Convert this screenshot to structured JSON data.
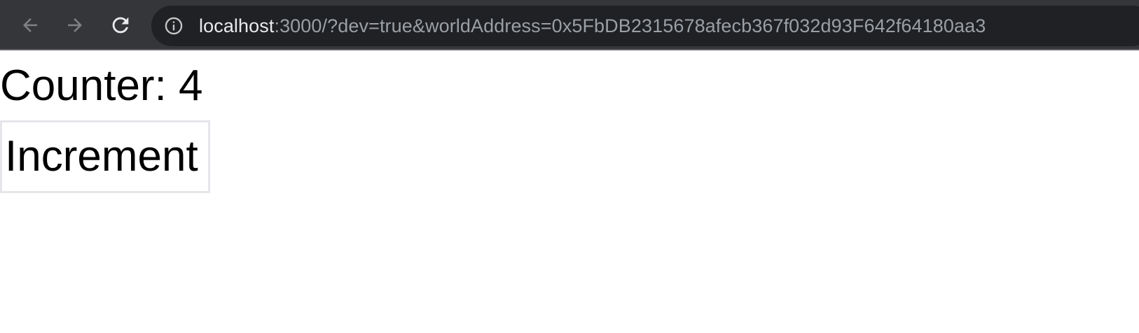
{
  "browser": {
    "url_host": "localhost",
    "url_rest": ":3000/?dev=true&worldAddress=0x5FbDB2315678afecb367f032d93F642f64180aa3",
    "icons": {
      "back": "arrow-left-icon",
      "forward": "arrow-right-icon",
      "reload": "reload-icon",
      "site_info": "info-icon"
    },
    "colors": {
      "toolbar": "#35363a",
      "omnibox": "#202124",
      "host_text": "#e8eaed",
      "path_text": "#9aa0a6"
    }
  },
  "page": {
    "counter_label": "Counter: 4",
    "increment_button_label": "Increment"
  }
}
